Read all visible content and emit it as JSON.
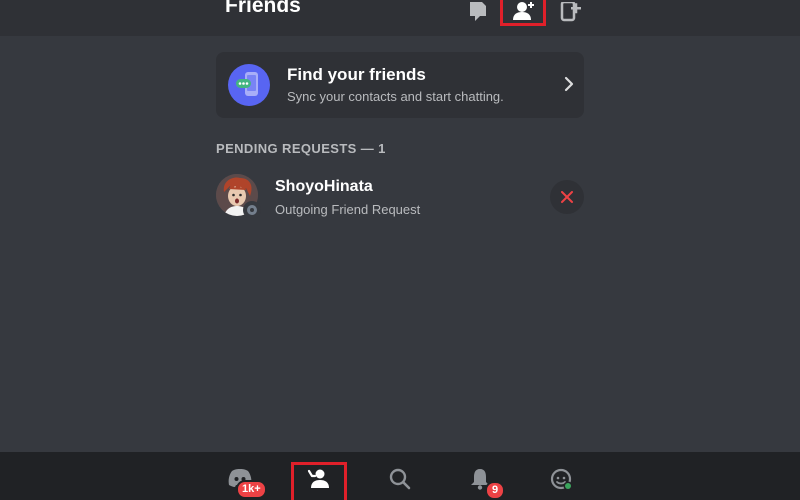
{
  "header": {
    "title": "Friends",
    "buttons": [
      {
        "name": "new-message-icon"
      },
      {
        "name": "add-friend-icon",
        "highlighted": true
      },
      {
        "name": "add-contact-icon"
      }
    ]
  },
  "find_friends": {
    "title": "Find your friends",
    "subtitle": "Sync your contacts and start chatting.",
    "icon": "contacts-phone-icon",
    "chevron": "chevron-right-icon"
  },
  "pending": {
    "header": "PENDING REQUESTS — 1",
    "requests": [
      {
        "name": "ShoyoHinata",
        "status": "Outgoing Friend Request",
        "avatar": "user-avatar",
        "status_indicator": "offline",
        "action_icon": "cancel-x-icon"
      }
    ]
  },
  "bottom_nav": {
    "items": [
      {
        "name": "servers",
        "icon": "discord-logo-icon",
        "badge": "1k+"
      },
      {
        "name": "friends",
        "icon": "friends-wave-icon",
        "highlighted": true
      },
      {
        "name": "search",
        "icon": "search-icon"
      },
      {
        "name": "notifications",
        "icon": "bell-icon",
        "badge": "9"
      },
      {
        "name": "profile",
        "icon": "profile-avatar-icon"
      }
    ]
  },
  "colors": {
    "background": "#36393f",
    "header_bg": "#2f3136",
    "nav_bg": "#202225",
    "accent": "#5865f2",
    "danger": "#ed4245",
    "highlight_box": "#e0202a",
    "muted_text": "#b9bbbe"
  }
}
